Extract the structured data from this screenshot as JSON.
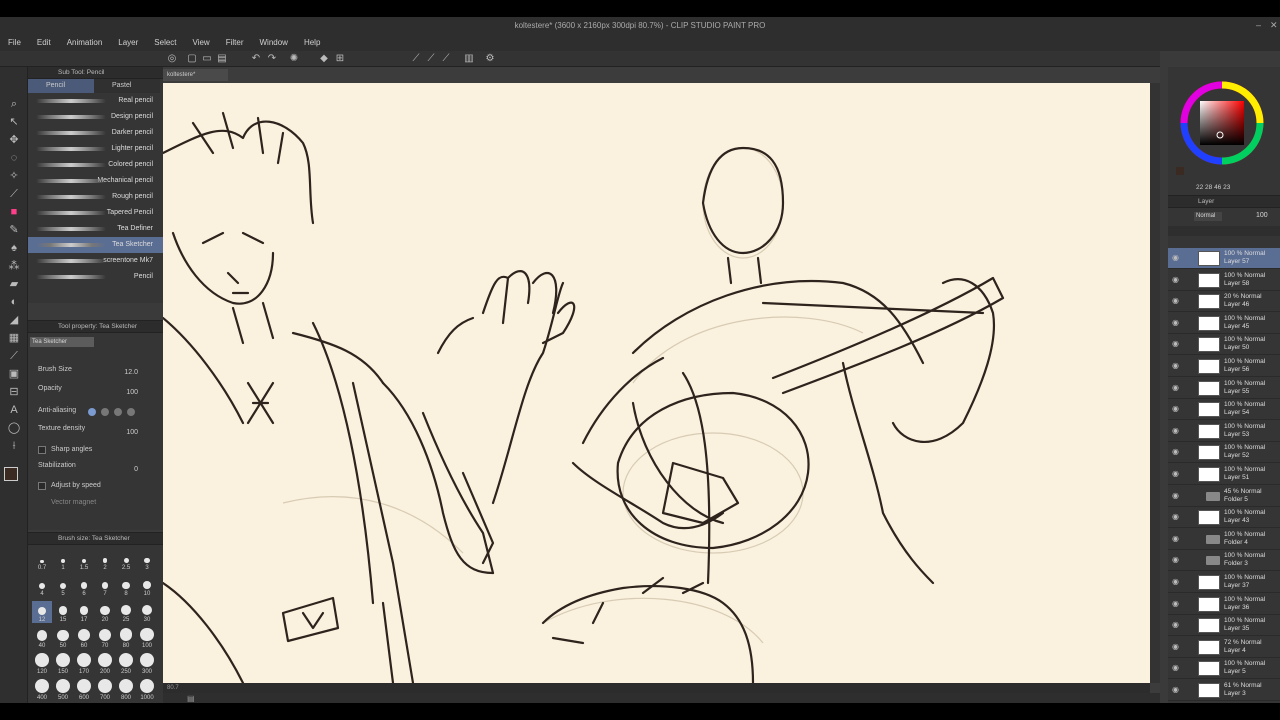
{
  "window": {
    "title": "koltestere* (3600 x 2160px 300dpi 80.7%) - CLIP STUDIO PAINT PRO"
  },
  "menu": [
    "File",
    "Edit",
    "Animation",
    "Layer",
    "Select",
    "View",
    "Filter",
    "Window",
    "Help"
  ],
  "subtool": {
    "header": "Sub Tool: Pencil",
    "tabs": [
      "Pencil",
      "Pastel"
    ],
    "brushes": [
      {
        "label": "Real pencil",
        "selected": false
      },
      {
        "label": "Design pencil",
        "selected": false
      },
      {
        "label": "Darker pencil",
        "selected": false
      },
      {
        "label": "Lighter pencil",
        "selected": false
      },
      {
        "label": "Colored pencil",
        "selected": false
      },
      {
        "label": "Mechanical pencil",
        "selected": false
      },
      {
        "label": "Rough pencil",
        "selected": false
      },
      {
        "label": "Tapered Pencil",
        "selected": false
      },
      {
        "label": "Tea Definer",
        "selected": false
      },
      {
        "label": "Tea Sketcher",
        "selected": true
      },
      {
        "label": "screentone Mk7",
        "selected": false
      },
      {
        "label": "Pencil",
        "selected": false
      }
    ]
  },
  "toolprop": {
    "header": "Tool property: Tea Sketcher",
    "name": "Tea Sketcher",
    "brush_size_label": "Brush Size",
    "brush_size_value": "12.0",
    "opacity_label": "Opacity",
    "opacity_value": "100",
    "antialias_label": "Anti-aliasing",
    "texture_label": "Texture density",
    "texture_value": "100",
    "sharp_label": "Sharp angles",
    "stab_label": "Stabilization",
    "stab_value": "0",
    "speed_label": "Adjust by speed",
    "vector_label": "Vector magnet"
  },
  "brushsize": {
    "header": "Brush size: Tea Sketcher",
    "sizes": [
      "0.7",
      "1",
      "1.5",
      "2",
      "2.5",
      "3",
      "4",
      "5",
      "6",
      "7",
      "8",
      "10",
      "12",
      "15",
      "17",
      "20",
      "25",
      "30",
      "40",
      "50",
      "60",
      "70",
      "80",
      "100",
      "120",
      "150",
      "170",
      "200",
      "250",
      "300",
      "400",
      "500",
      "600",
      "700",
      "800",
      "1000"
    ]
  },
  "document": {
    "tab": "koltestere*",
    "zoom": "80.7"
  },
  "color": {
    "hue_ring": "#ff0000",
    "main": "#3a2a22",
    "sub": "#e0a060",
    "readout": "22 28 46 23"
  },
  "layers": {
    "header": "Layer",
    "blend": "Normal",
    "opacity": "100",
    "rows": [
      {
        "opacity": "100 % Normal",
        "name": "Layer 57",
        "type": "layer",
        "selected": true
      },
      {
        "opacity": "100 % Normal",
        "name": "Layer 58",
        "type": "layer",
        "selected": false
      },
      {
        "opacity": "20 % Normal",
        "name": "Layer 46",
        "type": "layer",
        "selected": false
      },
      {
        "opacity": "100 % Normal",
        "name": "Layer 45",
        "type": "layer",
        "selected": false
      },
      {
        "opacity": "100 % Normal",
        "name": "Layer 50",
        "type": "layer",
        "selected": false
      },
      {
        "opacity": "100 % Normal",
        "name": "Layer 56",
        "type": "layer",
        "selected": false
      },
      {
        "opacity": "100 % Normal",
        "name": "Layer 55",
        "type": "layer",
        "selected": false
      },
      {
        "opacity": "100 % Normal",
        "name": "Layer 54",
        "type": "layer",
        "selected": false
      },
      {
        "opacity": "100 % Normal",
        "name": "Layer 53",
        "type": "layer",
        "selected": false
      },
      {
        "opacity": "100 % Normal",
        "name": "Layer 52",
        "type": "layer",
        "selected": false
      },
      {
        "opacity": "100 % Normal",
        "name": "Layer 51",
        "type": "layer",
        "selected": false
      },
      {
        "opacity": "45 % Normal",
        "name": "Folder 5",
        "type": "folder",
        "selected": false
      },
      {
        "opacity": "100 % Normal",
        "name": "Layer 43",
        "type": "layer",
        "selected": false
      },
      {
        "opacity": "100 % Normal",
        "name": "Folder 4",
        "type": "folder",
        "selected": false
      },
      {
        "opacity": "100 % Normal",
        "name": "Folder 3",
        "type": "folder",
        "selected": false
      },
      {
        "opacity": "100 % Normal",
        "name": "Layer 37",
        "type": "layer",
        "selected": false
      },
      {
        "opacity": "100 % Normal",
        "name": "Layer 36",
        "type": "layer",
        "selected": false
      },
      {
        "opacity": "100 % Normal",
        "name": "Layer 35",
        "type": "layer",
        "selected": false
      },
      {
        "opacity": "72 % Normal",
        "name": "Layer 4",
        "type": "layer",
        "selected": false
      },
      {
        "opacity": "100 % Normal",
        "name": "Layer 5",
        "type": "layer",
        "selected": false
      },
      {
        "opacity": "61 % Normal",
        "name": "Layer 3",
        "type": "layer",
        "selected": false
      }
    ]
  }
}
